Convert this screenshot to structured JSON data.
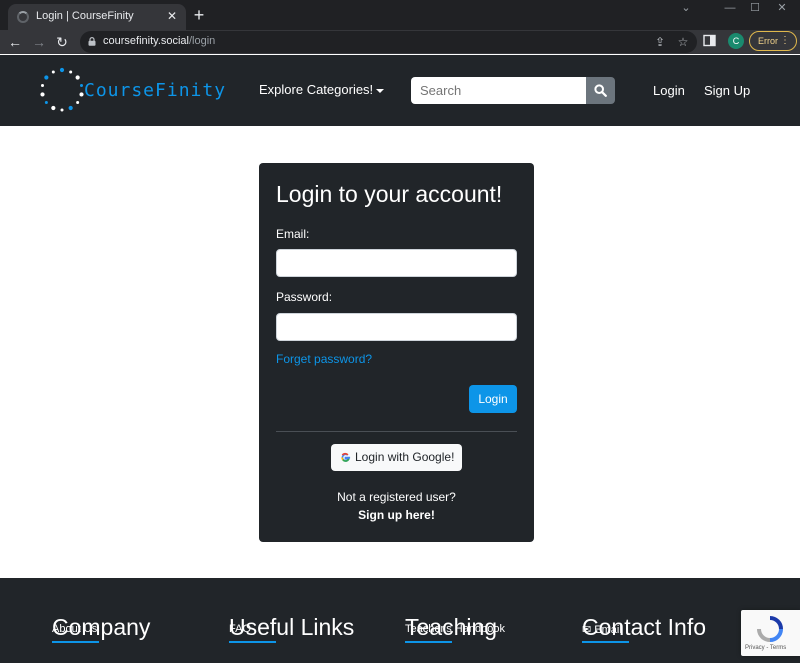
{
  "browser": {
    "tab_title": "Login | CourseFinity",
    "url_host": "coursefinity.social",
    "url_path": "/login",
    "profile_initial": "C",
    "error_label": "Error"
  },
  "navbar": {
    "brand": "CourseFinity",
    "explore": "Explore Categories!",
    "search_placeholder": "Search",
    "login": "Login",
    "signup": "Sign Up",
    "brand_color": "#0d95e8"
  },
  "card": {
    "title": "Login to your account!",
    "email_label": "Email:",
    "password_label": "Password:",
    "forgot": "Forget password?",
    "login_button": "Login",
    "google_button": "Login with Google!",
    "not_registered": "Not a registered user?",
    "signup_link": "Sign up here!"
  },
  "footer": {
    "columns": [
      {
        "heading": "Company",
        "first_item": "About Us"
      },
      {
        "heading": "Useful Links",
        "first_item": "FAQ"
      },
      {
        "heading": "Teaching",
        "first_item": "Teacher's Handbook"
      },
      {
        "heading": "Contact Info",
        "first_item": "Email"
      }
    ]
  },
  "recaptcha": {
    "text": "Privacy - Terms"
  }
}
